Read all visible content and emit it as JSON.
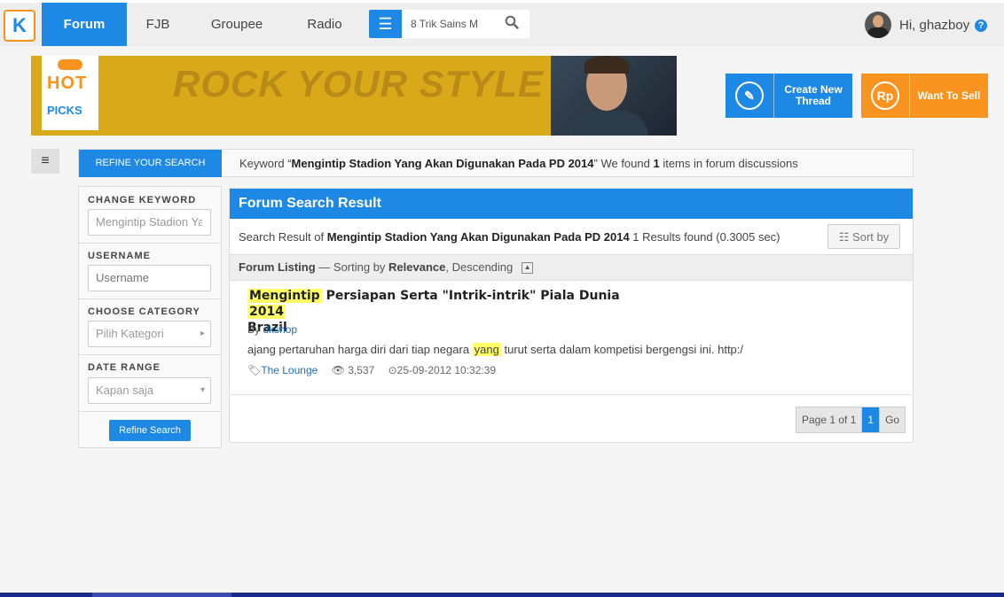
{
  "nav": {
    "logo": "K",
    "tabs": [
      {
        "label": "Forum",
        "active": true
      },
      {
        "label": "FJB",
        "active": false
      },
      {
        "label": "Groupee",
        "active": false
      },
      {
        "label": "Radio",
        "active": false
      }
    ],
    "search_value": "8 Trik Sains M",
    "greeting": "Hi, ghazboy",
    "help": "?"
  },
  "banner": {
    "hot": "HOT",
    "picks": "PICKS",
    "text": "ROCK YOUR STYLE OUT"
  },
  "actions": {
    "create_icon": "✎",
    "create_label": "Create New Thread",
    "sell_icon": "Rp",
    "sell_label": "Want To Sell"
  },
  "refine": {
    "toggle": "≡",
    "tab_label": "REFINE YOUR SEARCH",
    "keyword_prefix": "Keyword “",
    "keyword": "Mengintip Stadion Yang Akan Digunakan Pada PD 2014",
    "keyword_mid": "” We found ",
    "count": "1",
    "keyword_suffix": " items in forum discussions"
  },
  "sidebar": {
    "change_keyword_label": "CHANGE KEYWORD",
    "keyword_value": "Mengintip Stadion Yang",
    "username_label": "USERNAME",
    "username_placeholder": "Username",
    "category_label": "CHOOSE CATEGORY",
    "category_value": "Pilih Kategori",
    "date_label": "DATE RANGE",
    "date_value": "Kapan saja",
    "refine_button": "Refine Search"
  },
  "results": {
    "header": "Forum Search Result",
    "summary_prefix": "Search Result of ",
    "summary_query": "Mengintip Stadion Yang Akan Digunakan Pada PD 2014",
    "summary_suffix": " 1 Results found (0.3005 sec)",
    "sort_label": "Sort by",
    "listing_label": "Forum Listing",
    "listing_sort_prefix": " — Sorting by ",
    "listing_sort_field": "Relevance",
    "listing_sort_order": ", Descending",
    "items": [
      {
        "title_hl1": "Mengintip",
        "title_mid": " Persiapan Serta \"Intrik-intrik\" Piala Dunia ",
        "title_hl2": "2014",
        "title_end": "Brazil",
        "by": "By ",
        "author": "dkshop",
        "snippet_pre": "ajang pertaruhan harga diri dari tiap negara ",
        "snippet_hl": "yang",
        "snippet_post": " turut serta dalam kompetisi bergengsi ini. http:/",
        "category": "The Lounge",
        "views": "3,537",
        "date": "25-09-2012 10:32:39"
      }
    ],
    "pager": {
      "info": "Page 1 of 1",
      "current": "1",
      "go": "Go"
    }
  }
}
